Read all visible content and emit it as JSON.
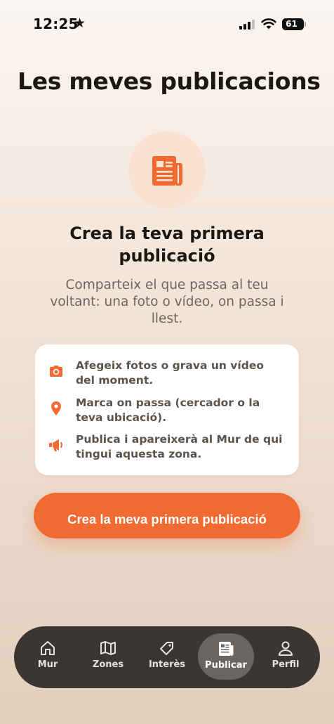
{
  "status_bar": {
    "time": "12:25",
    "star": "★",
    "battery": "61"
  },
  "page": {
    "title": "Les meves publicacions"
  },
  "empty_state": {
    "icon": "newspaper-icon",
    "heading": "Crea la teva primera publicació",
    "subtitle": "Comparteix el que passa al teu voltant: una foto o vídeo, on passa i llest."
  },
  "tips": [
    {
      "icon": "camera-icon",
      "text": "Afegeix fotos o grava un vídeo del moment."
    },
    {
      "icon": "location-pin-icon",
      "text": "Marca on passa (cercador o la teva ubicació)."
    },
    {
      "icon": "megaphone-icon",
      "text": "Publica i apareixerà al Mur de qui tingui aquesta zona."
    }
  ],
  "cta": {
    "label": "Crea la meva primera publicació"
  },
  "tab_bar": {
    "active": "Publicar",
    "tabs": [
      {
        "icon": "home-icon",
        "label": "Mur"
      },
      {
        "icon": "map-icon",
        "label": "Zones"
      },
      {
        "icon": "tag-icon",
        "label": "Interès"
      },
      {
        "icon": "newspaper-icon",
        "label": "Publicar"
      },
      {
        "icon": "person-icon",
        "label": "Perfil"
      }
    ]
  },
  "colors": {
    "accent": "#f06a31",
    "accent_soft": "#fae2d3",
    "tab_bar_bg": "#3c3633",
    "tab_active_bg": "#6b6562",
    "text_dark": "#1d1712",
    "text_muted": "#6d6560"
  }
}
